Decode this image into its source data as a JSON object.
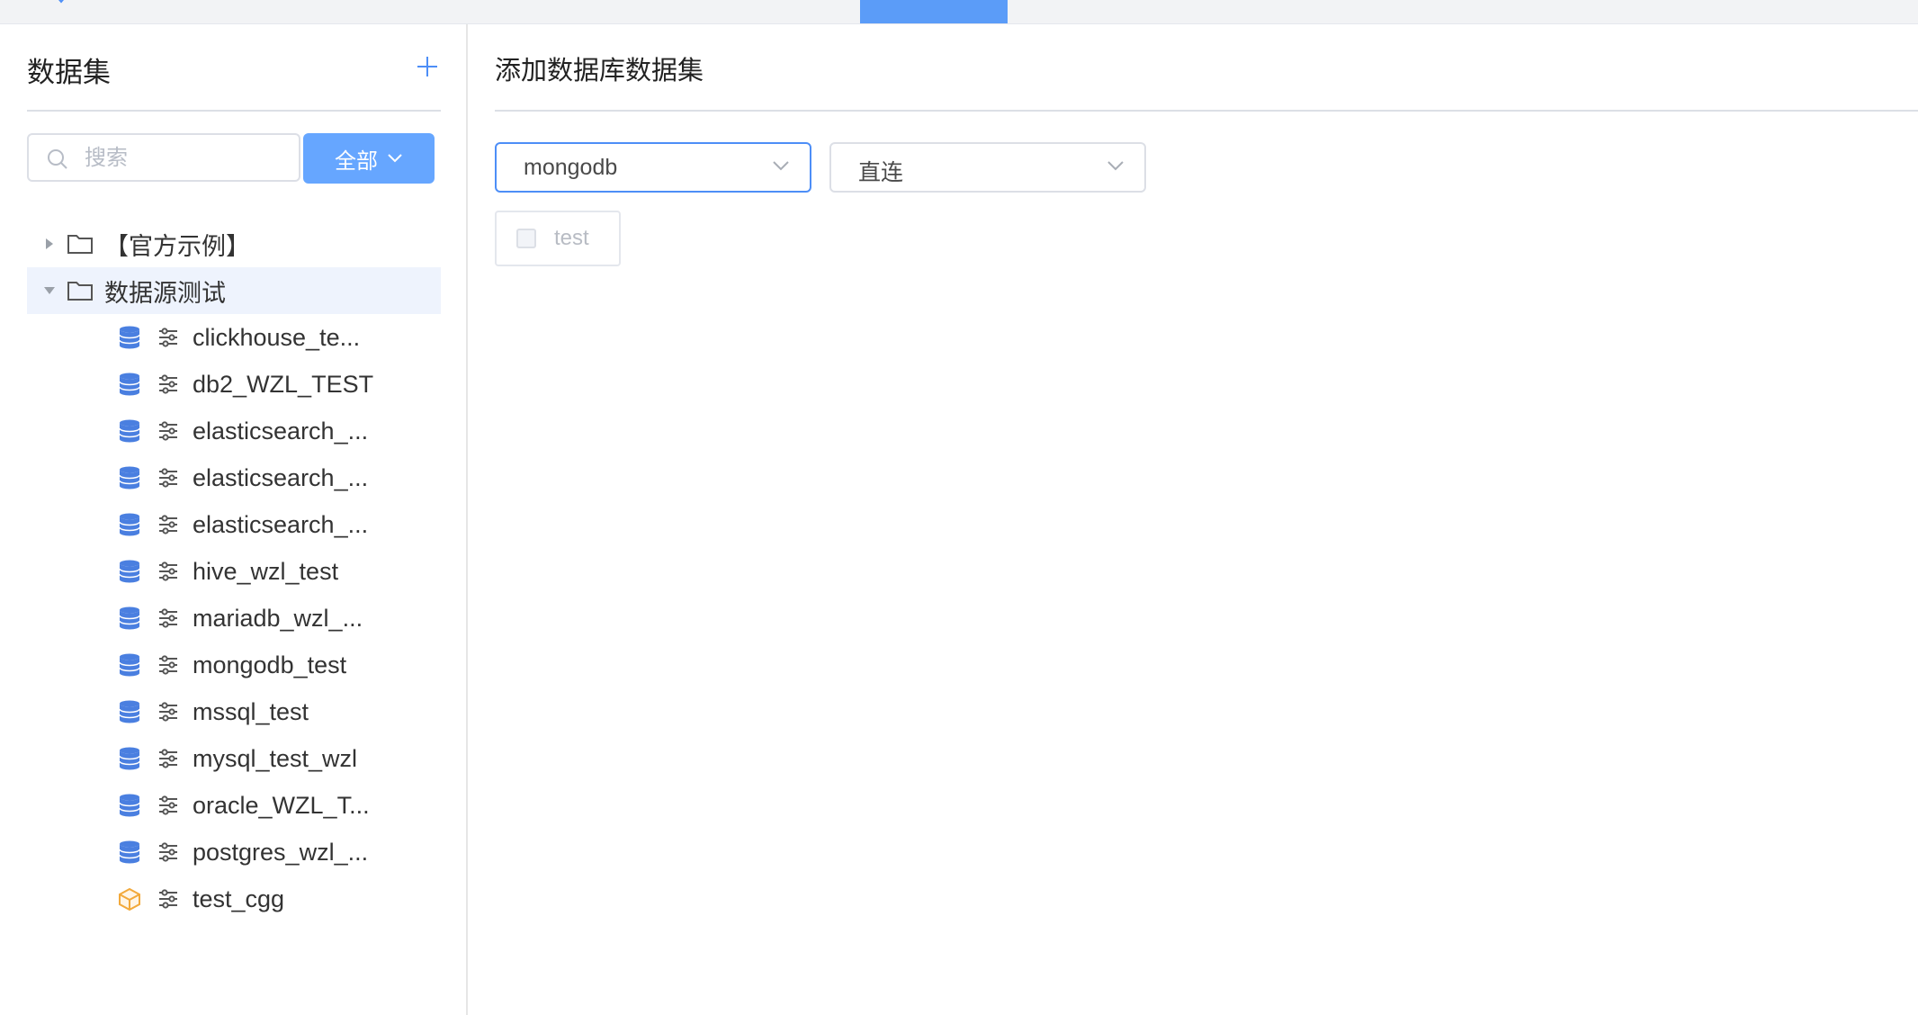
{
  "sidebar": {
    "title": "数据集",
    "search": {
      "placeholder": "搜索",
      "value": ""
    },
    "filter_label": "全部",
    "tree": [
      {
        "label": "【官方示例】",
        "expanded": false
      },
      {
        "label": "数据源测试",
        "expanded": true,
        "children": [
          {
            "label": "clickhouse_te...",
            "icon": "database-icon"
          },
          {
            "label": "db2_WZL_TEST",
            "icon": "database-icon"
          },
          {
            "label": "elasticsearch_...",
            "icon": "database-icon"
          },
          {
            "label": "elasticsearch_...",
            "icon": "database-icon"
          },
          {
            "label": "elasticsearch_...",
            "icon": "database-icon"
          },
          {
            "label": "hive_wzl_test",
            "icon": "database-icon"
          },
          {
            "label": "mariadb_wzl_...",
            "icon": "database-icon"
          },
          {
            "label": "mongodb_test",
            "icon": "database-icon"
          },
          {
            "label": "mssql_test",
            "icon": "database-icon"
          },
          {
            "label": "mysql_test_wzl",
            "icon": "database-icon"
          },
          {
            "label": "oracle_WZL_T...",
            "icon": "database-icon"
          },
          {
            "label": "postgres_wzl_...",
            "icon": "database-icon"
          },
          {
            "label": "test_cgg",
            "icon": "cube-icon"
          }
        ]
      }
    ]
  },
  "main": {
    "title": "添加数据库数据集",
    "datasource_select": "mongodb",
    "mode_select": "直连",
    "tables": [
      {
        "label": "test",
        "checked": false
      }
    ]
  },
  "colors": {
    "accent": "#4d8ef7",
    "button": "#66a6ff",
    "db_icon": "#4a7fe0",
    "cube_icon": "#f2a93b",
    "active_row": "#eef3fd"
  }
}
